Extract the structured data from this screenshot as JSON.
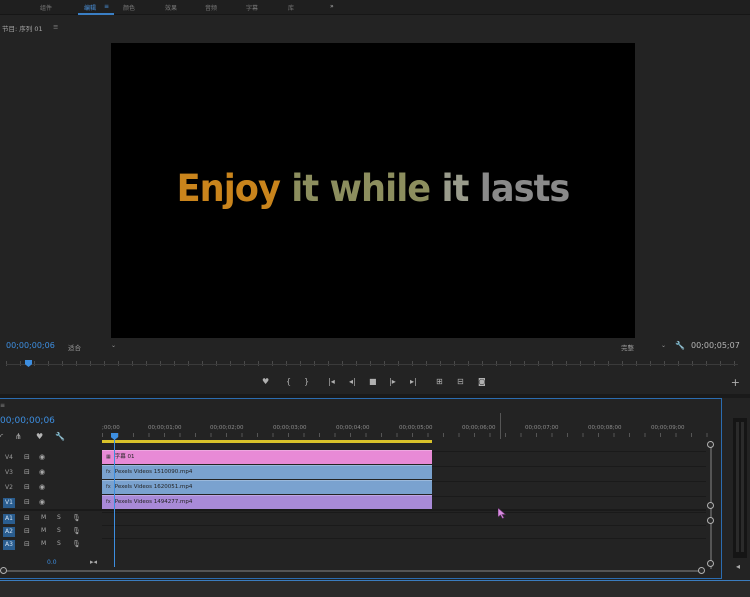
{
  "workspaces": {
    "items": [
      {
        "label": "组件",
        "active": false
      },
      {
        "label": "编辑",
        "active": true
      },
      {
        "label": "颜色",
        "active": false
      },
      {
        "label": "效果",
        "active": false
      },
      {
        "label": "音频",
        "active": false
      },
      {
        "label": "字幕",
        "active": false
      },
      {
        "label": "库",
        "active": false
      }
    ],
    "edit_menu_glyph": "≡",
    "overflow": "»"
  },
  "program_monitor": {
    "title": "节目: 序列 01",
    "menu_glyph": "≡",
    "caption_words": [
      "Enjoy",
      "it while",
      "it",
      "lasts"
    ],
    "current_timecode": "00;00;00;06",
    "fit_value": "适合",
    "quality_value": "完整",
    "duration_timecode": "00;00;05;07",
    "transport": [
      "marker-icon",
      "mark-in-icon",
      "mark-out-icon",
      "go-to-in-icon",
      "step-back-icon",
      "stop-icon",
      "step-forward-icon",
      "go-to-out-icon",
      "insert-icon",
      "overwrite-icon",
      "camera-icon",
      "add-icon"
    ]
  },
  "timeline": {
    "index_label": "≡",
    "timecode": "00;00;00;06",
    "ruler_labels": [
      ";00;00",
      "00;00;01;00",
      "00;00;02;00",
      "00;00;03;00",
      "00;00;04;00",
      "00;00;05;00",
      "00;00;06;00",
      "00;00;07;00",
      "00;00;08;00",
      "00;00;09;00"
    ],
    "video_tracks": [
      {
        "name": "V4",
        "targeted": false
      },
      {
        "name": "V3",
        "targeted": false
      },
      {
        "name": "V2",
        "targeted": false
      },
      {
        "name": "V1",
        "targeted": true
      }
    ],
    "audio_tracks": [
      {
        "name": "A1",
        "targeted": true,
        "m": "M",
        "s": "S"
      },
      {
        "name": "A2",
        "targeted": true,
        "m": "M",
        "s": "S"
      },
      {
        "name": "A3",
        "targeted": true,
        "m": "M",
        "s": "S"
      }
    ],
    "clips": {
      "v4": {
        "label": "字幕 01",
        "color": "#e88ad6"
      },
      "v3": {
        "label": "Pexels Videos 1510090.mp4",
        "color": "#7aa2cf"
      },
      "v2": {
        "label": "Pexels Videos 1620051.mp4",
        "color": "#7aa2cf"
      },
      "v1": {
        "label": "Pexels Videos 1494277.mp4",
        "color": "#a98ad8"
      }
    },
    "master_value": "0.0",
    "fx_badge": "fx"
  },
  "colors": {
    "accent": "#3d8ee0",
    "work_area": "#d8c22a"
  }
}
